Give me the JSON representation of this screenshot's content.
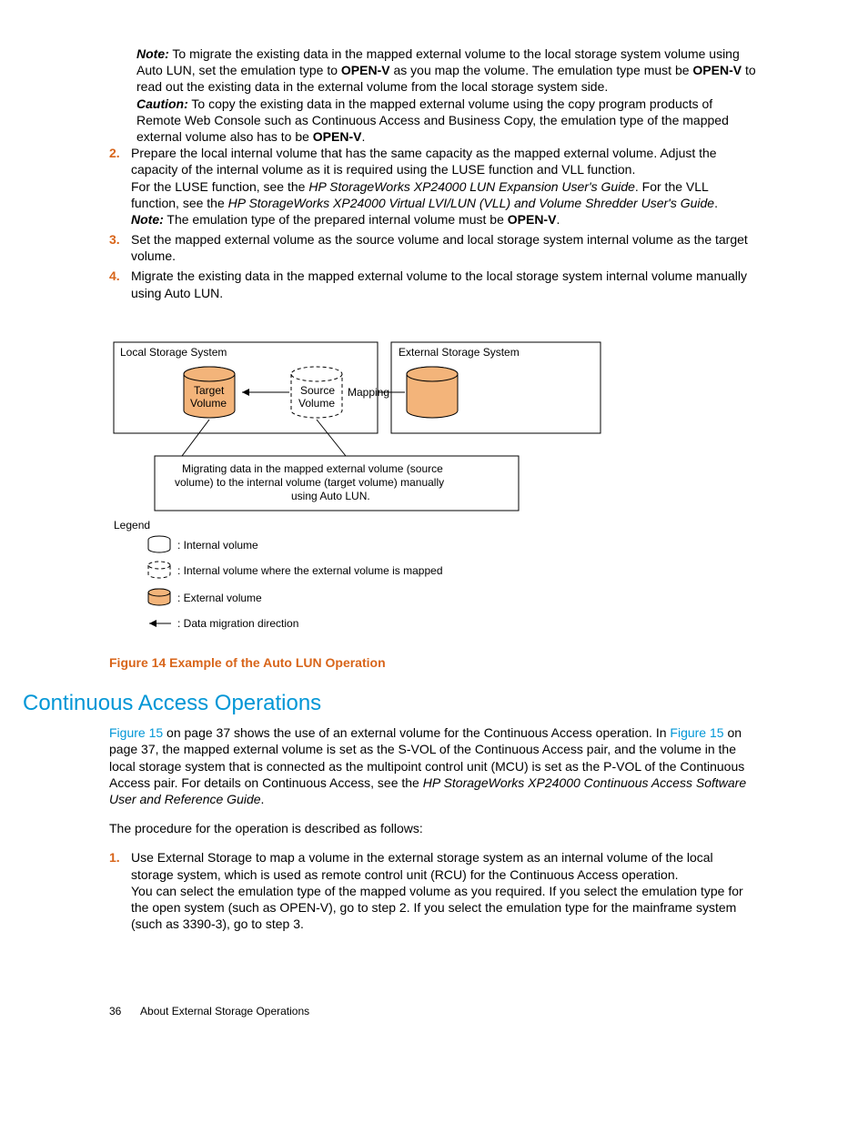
{
  "notes": {
    "n1a": "Note:",
    "n1b": " To migrate the existing data in the mapped external volume to the local storage system volume using Auto LUN, set the emulation type to ",
    "n1c": "OPEN-V",
    "n1d": " as you map the volume. The emulation type must be ",
    "n1e": "OPEN-V",
    "n1f": " to read out the existing data in the external volume from the local storage system side.",
    "c1a": "Caution:",
    "c1b": " To copy the existing data in the mapped external volume using the copy program products of Remote Web Console such as Continuous Access and Business Copy, the emulation type of the mapped external volume also has to be ",
    "c1c": "OPEN-V",
    "c1d": "."
  },
  "steps": {
    "s2n": "2.",
    "s2a": "Prepare the local internal volume that has the same capacity as the mapped external volume. Adjust the capacity of the internal volume as it is required using the LUSE function and VLL function.",
    "s2b": "For the LUSE function, see the ",
    "s2c": "HP StorageWorks XP24000 LUN Expansion User's Guide",
    "s2d": ". For the VLL function, see the ",
    "s2e": "HP StorageWorks XP24000 Virtual LVI/LUN (VLL) and Volume Shredder User's Guide",
    "s2f": ".",
    "s2g": "Note:",
    "s2h": " The emulation type of the prepared internal volume must be ",
    "s2i": "OPEN-V",
    "s2j": ".",
    "s3n": "3.",
    "s3a": "Set the mapped external volume as the source volume and local storage system internal volume as the target volume.",
    "s4n": "4.",
    "s4a": "Migrate the existing data in the mapped external volume to the local storage system internal volume manually using Auto LUN."
  },
  "diagram": {
    "local": "Local Storage System",
    "external": "External Storage System",
    "target1": "Target",
    "target2": "Volume",
    "source1": "Source",
    "source2": "Volume",
    "mapping": "Mapping",
    "desc1": "Migrating data in the mapped external volume (source",
    "desc2": "volume) to the internal volume (target volume) manually",
    "desc3": "using Auto LUN.",
    "legend": "Legend",
    "l1": ": Internal volume",
    "l2": ": Internal volume where the external volume is mapped",
    "l3": ": External volume",
    "l4": ": Data migration direction"
  },
  "figcap": "Figure 14 Example of the Auto LUN Operation",
  "section": "Continuous Access Operations",
  "para": {
    "p1a": "Figure 15",
    "p1b": " on page 37 shows the use of an external volume for the Continuous Access operation. In ",
    "p1c": "Figure 15",
    "p1d": " on page 37, the mapped external volume is set as the S-VOL of the Continuous Access pair, and the volume in the local storage system that is connected as the multipoint control unit (MCU) is set as the P-VOL of the Continuous Access pair. For details on Continuous Access, see the ",
    "p1e": "HP StorageWorks XP24000 Continuous Access Software User and Reference Guide",
    "p1f": ".",
    "p2": "The procedure for the operation is described as follows:"
  },
  "steps2": {
    "s1n": "1.",
    "s1a": "Use External Storage to map a volume in the external storage system as an internal volume of the local storage system, which is used as remote control unit (RCU) for the Continuous Access operation.",
    "s1b": "You can select the emulation type of the mapped volume as you required. If you select the emulation type for the open system (such as OPEN-V), go to step 2. If you select the emulation type for the mainframe system (such as 3390-3), go to step 3."
  },
  "footer": {
    "page": "36",
    "title": "About External Storage Operations"
  }
}
